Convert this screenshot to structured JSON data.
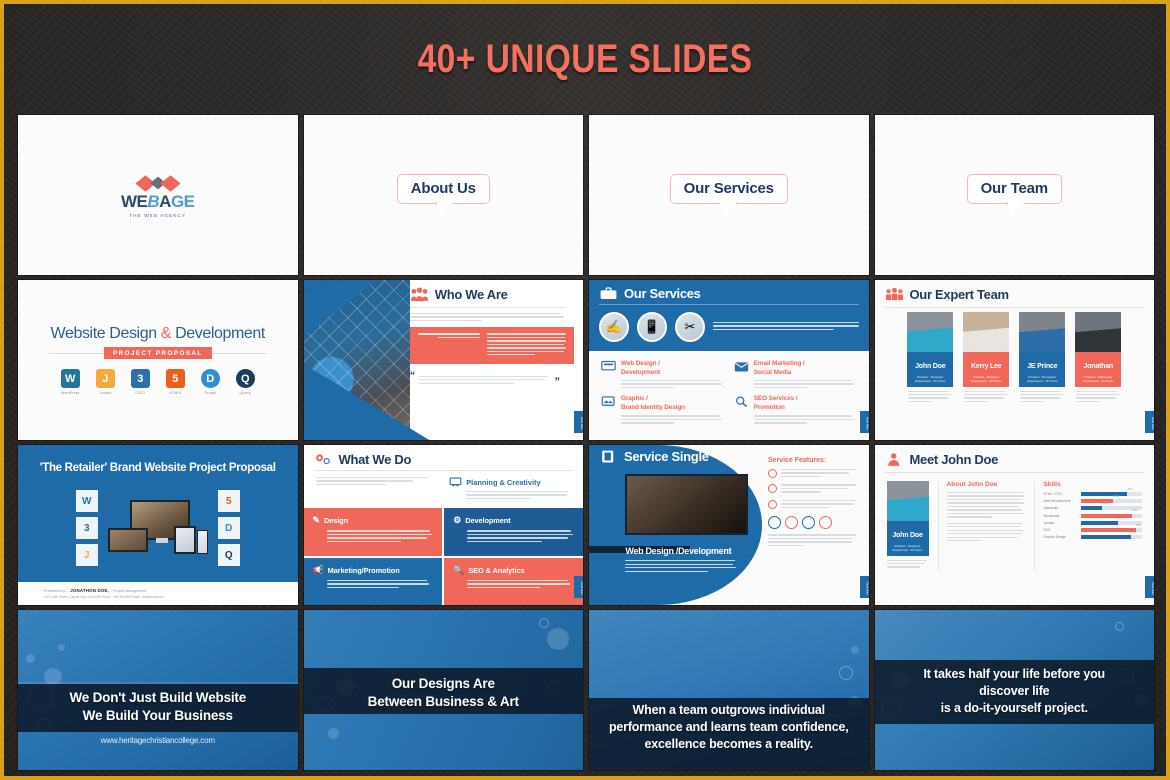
{
  "hero": {
    "title": "40+ UNIQUE SLIDES",
    "accent": "#f4715f",
    "background": "#2b2927",
    "border": "#d9a21b"
  },
  "palette": {
    "blue": "#1e6ba8",
    "dark_blue": "#1f3b5c",
    "salmon": "#f0685a",
    "light": "#fbfbfb"
  },
  "slides": {
    "logo": {
      "name_part1": "WE",
      "name_part2": "B",
      "name_part3": "A",
      "name_part4": "GE",
      "tagline": "THE WEB AGENCY"
    },
    "about_us": {
      "label": "About Us"
    },
    "our_services_title": {
      "label": "Our Services"
    },
    "our_team_title": {
      "label": "Our Team"
    },
    "website_design": {
      "heading_1": "Website Design ",
      "heading_amp": "&",
      "heading_2": " Development",
      "banner": "PROJECT PROPOSAL",
      "tech": [
        {
          "name": "WordPress",
          "glyph": "W",
          "color": "#21759b"
        },
        {
          "name": "Joomla",
          "glyph": "J",
          "color": "#f4a93c"
        },
        {
          "name": "CSS3",
          "glyph": "3",
          "color": "#2d6fa8"
        },
        {
          "name": "HTML5",
          "glyph": "5",
          "color": "#e8601c"
        },
        {
          "name": "Drupal",
          "glyph": "D",
          "color": "#2d8fd5"
        },
        {
          "name": "jQuery",
          "glyph": "Q",
          "color": "#1a3d5c"
        }
      ]
    },
    "who_we_are": {
      "title": "Who We Are",
      "icon": "people-group-icon",
      "intro": "Lorem Ipsum is simply dummy text of the printing and typesetting industry. Lorem Ipsum has been the industry's standard dummy text ever since the 1500s, when an unknown.",
      "highlight": "Lorem Ipsum is simply dummy text of",
      "highlight_body": "Lorem Ipsum is simply dummy text of the printing and typesetting industry. Lorem Ipsum has been the industry's standard dummy text ever since the 1500s, when an unknown printer took a galley of type and scrambled it to make a type specimen book. It has survived not only five centuries, but also the leap into electronic typesetting.",
      "quote": "Lorem Ipsum is simply dummy text of the printing and typesetting industry. Lorem Ipsum has been the industry's standard dummy text ever since 1500."
    },
    "our_services": {
      "title": "Our Services",
      "icon": "briefcase-icon",
      "intro": "Lorem Ipsum is simply dummy text of the printing and typesetting industry. Lorem Ipsum has been the industry's",
      "items": [
        {
          "title": "Web Design /\nDevelopment",
          "icon": "monitor-icon",
          "body": "Lorem Ipsum is simply dummy text of the printing and typesetting industry. Lorem Ipsum has been the industry's standard dummy text ever since the 1500s."
        },
        {
          "title": "Email Marketing /\nSocial Media",
          "icon": "envelope-icon",
          "body": "Lorem Ipsum is simply dummy text of the printing and typesetting industry. Lorem Ipsum has been the industry's standard dummy text ever since the 1500s."
        },
        {
          "title": "Graphic /\nBrand Identity Design",
          "icon": "palette-icon",
          "body": "Lorem Ipsum is simply dummy text of the printing and typesetting industry. Lorem Ipsum has been the industry's standard dummy text ever since the 1500s."
        },
        {
          "title": "SEO Services /\nPromotion",
          "icon": "magnifier-icon",
          "body": "Lorem Ipsum is simply dummy text of the printing and typesetting industry. Lorem Ipsum has been the industry's standard dummy text ever since the 1500s."
        }
      ]
    },
    "expert_team": {
      "title": "Our Expert Team",
      "icon": "three-people-icon",
      "members": [
        {
          "name": "John Doe",
          "role": "Position : Designer\nExperience : 10 Years",
          "accent": "blue",
          "body": "Lorem Ipsum is simply dummy text of the printing and typesetting industry. Lorem Ipsum has been the industry."
        },
        {
          "name": "Kerry Lee",
          "role": "Position : Designer\nExperience : 10 Years",
          "accent": "salmon",
          "body": "Lorem Ipsum is simply dummy text of the printing and typesetting industry. Lorem Ipsum has been the industry."
        },
        {
          "name": "JE Prince",
          "role": "Position : Developer\nExperience : 10 Years",
          "accent": "blue",
          "body": "Lorem Ipsum is simply dummy text of the printing and typesetting industry. Lorem Ipsum has been the industry."
        },
        {
          "name": "Jonathan",
          "role": "Position : Marketing\nExperience : 10 Years",
          "accent": "salmon",
          "body": "Lorem Ipsum is simply dummy text of the printing and typesetting industry. Lorem Ipsum has been the industry."
        }
      ]
    },
    "retailer": {
      "title": "'The Retailer' Brand Website Project Proposal",
      "presented_label": "Presented by:",
      "presenter": "JONATHON DOE,",
      "presenter_role": "Project Management",
      "address": "1201 34th Street, Capital City, ca 90288  Phone : 444 456 566  Email : info@mail.com",
      "tech_left": [
        {
          "name": "WordPress",
          "glyph": "W",
          "color": "#21759b"
        },
        {
          "name": "CSS",
          "glyph": "3",
          "color": "#2d6fa8"
        },
        {
          "name": "Joomla",
          "glyph": "J",
          "color": "#f4a93c"
        }
      ],
      "tech_right": [
        {
          "name": "HTML",
          "glyph": "5",
          "color": "#e8601c"
        },
        {
          "name": "Drupal",
          "glyph": "D",
          "color": "#2d8fd5"
        },
        {
          "name": "jQuery",
          "glyph": "Q",
          "color": "#1a3d5c"
        }
      ]
    },
    "what_we_do": {
      "title": "What We Do",
      "icon": "gears-icon",
      "quote": "\"Lorem Ipsum is simply dummy text of the printing and typesetting industry. Lorem Ipsum has\"",
      "planning": {
        "title": "Planning & Creativity",
        "icon": "easel-icon",
        "body": "Lorem Ipsum is simply dummy text of the printing and typesetting industry. Lorem Ipsum has been the industry's standard dummy text ever since the 1500s."
      },
      "cells": [
        {
          "title": "Design",
          "icon": "pen-icon",
          "color": "red",
          "body": "Lorem Ipsum is simply dummy text of the printing and typesetting industry. Lorem Ipsum has been the industry's standard dummy text ever since the 1500s, when an unknown printer."
        },
        {
          "title": "Development",
          "icon": "code-icon",
          "color": "blue",
          "body": "Lorem Ipsum is simply dummy text of the printing and typesetting industry. Lorem Ipsum has been the industry's standard dummy text ever since the 1500s, when an unknown printer took a galley of type."
        },
        {
          "title": "Marketing/Promotion",
          "icon": "megaphone-icon",
          "color": "blue2",
          "body": "Lorem Ipsum is simply dummy text of the printing and typesetting industry. Lorem Ipsum has been the industry's standard dummy text ever since the 1500s."
        },
        {
          "title": "SEO & Analytics",
          "icon": "chart-icon",
          "color": "red",
          "body": "Lorem Ipsum is simply dummy text of the printing and typesetting industry. Lorem Ipsum has been the industry's standard dummy text ever since the 1500s."
        }
      ]
    },
    "service_single": {
      "title": "Service Single",
      "icon": "book-icon",
      "caption": "Web Design /Development",
      "caption_body": "Lorem Ipsum is simply dummy text of the printing and typesetting industry. Lorem Ipsum has been the industry's standard dummy text ever since the 1500s, when an unknown. Lorem Ipsum is simply dummy text.",
      "features_title": "Service Features:",
      "features": [
        "Lorem Ipsum is simply dummy text of the printing and typesetting.",
        "The industry's standard dummy text ever since 1500, when an unknown.",
        "Lorem typesetting industry. Lorem Ipsum has been the industry's standard dummy text."
      ],
      "footer": "Lorem Ipsum is simply dummy text of the printing and typesetting industry. Lorem Ipsum has been the industry's standard dummy text ever since."
    },
    "meet_john": {
      "title": "Meet John Doe",
      "icon": "person-icon",
      "card_name": "John Doe",
      "card_role": "Position : Designer\nExperience : 10 Years",
      "card_body": "Lorem Ipsum is simply dummy text of the printing and typesetting industry.",
      "about_title": "About John Doe",
      "about_p1": "Lorem Ipsum is simply dummy text of the printing and typesetting industry. Lorem Ipsum has been the industry's standard dummy text ever since the 1500s, when an unknown printer took a galley of type and scrambled it to make a type specimen book. It has survived not only five centuries.",
      "about_p2": "But also the leap into electronic typesetting, remaining essentially unchanged. It has. Lorem Ipsum is simply dummy text of the printing and typesetting industry. Lorem Ipsum has been the industry's standard dummy text ever since the 1500s.",
      "skills_title": "Skills",
      "skills": [
        {
          "label": "HTML / CSS",
          "value": 76,
          "color": "blue"
        },
        {
          "label": "Web Development",
          "value": 52,
          "color": "salmon"
        },
        {
          "label": "Javascript",
          "value": 34,
          "color": "blue"
        },
        {
          "label": "Wordpress",
          "value": 84,
          "color": "salmon"
        },
        {
          "label": "Joomla",
          "value": 60,
          "color": "blue"
        },
        {
          "label": "SEO",
          "value": 90,
          "color": "salmon"
        },
        {
          "label": "Graphic Design",
          "value": 82,
          "color": "blue"
        }
      ]
    },
    "quotes": [
      {
        "line1": "We Don't Just Build Website",
        "line2": "We Build Your Business",
        "line3": "",
        "url": "www.heritagechristiancollege.com"
      },
      {
        "line1": "Our Designs Are",
        "line2": "Between Business & Art",
        "line3": "",
        "url": ""
      },
      {
        "line1": "When a team outgrows individual",
        "line2": "performance and learns team confidence,",
        "line3": "excellence becomes a reality.",
        "url": ""
      },
      {
        "line1": "It takes half your life before you",
        "line2": "discover life",
        "line3": "is a do-it-yourself project.",
        "url": ""
      }
    ]
  },
  "side_tab_label": "Read More"
}
